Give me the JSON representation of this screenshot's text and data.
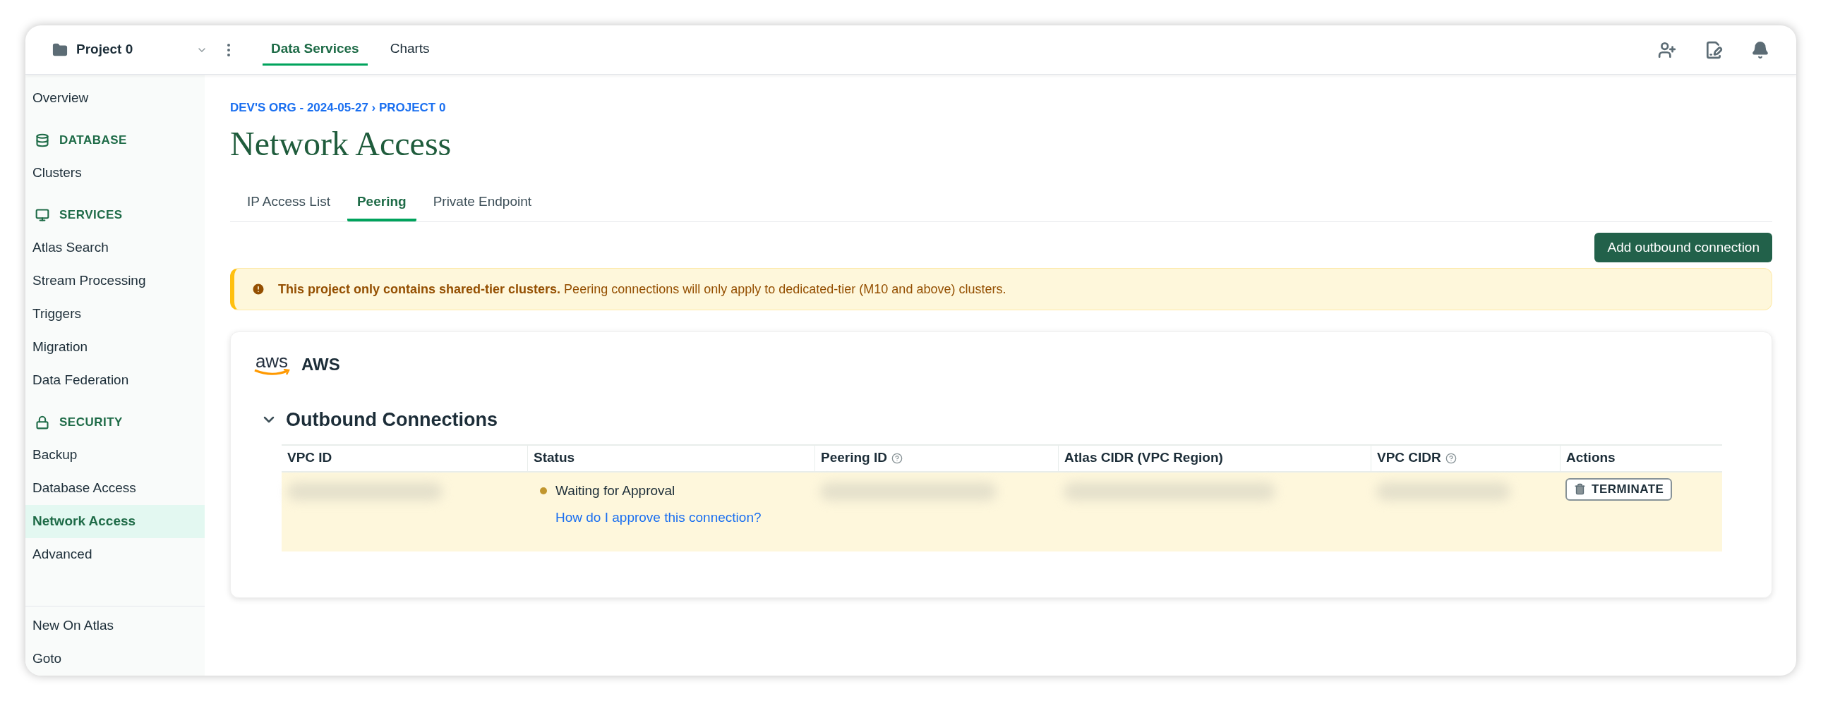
{
  "topbar": {
    "project": "Project 0",
    "nav": [
      {
        "label": "Data Services",
        "selected": true
      },
      {
        "label": "Charts",
        "selected": false
      }
    ]
  },
  "sidebar": {
    "items": [
      {
        "kind": "link",
        "label": "Overview",
        "selected": false
      },
      {
        "kind": "section",
        "label": "DATABASE"
      },
      {
        "kind": "link",
        "label": "Clusters",
        "selected": false
      },
      {
        "kind": "section",
        "label": "SERVICES"
      },
      {
        "kind": "link",
        "label": "Atlas Search",
        "selected": false
      },
      {
        "kind": "link",
        "label": "Stream Processing",
        "selected": false
      },
      {
        "kind": "link",
        "label": "Triggers",
        "selected": false
      },
      {
        "kind": "link",
        "label": "Migration",
        "selected": false
      },
      {
        "kind": "link",
        "label": "Data Federation",
        "selected": false
      },
      {
        "kind": "section",
        "label": "SECURITY"
      },
      {
        "kind": "link",
        "label": "Backup",
        "selected": false
      },
      {
        "kind": "link",
        "label": "Database Access",
        "selected": false
      },
      {
        "kind": "link",
        "label": "Network Access",
        "selected": true
      },
      {
        "kind": "link",
        "label": "Advanced",
        "selected": false
      }
    ],
    "footer": [
      "New On Atlas",
      "Goto"
    ]
  },
  "breadcrumb": "DEV'S ORG - 2024-05-27 › PROJECT 0",
  "title": "Network Access",
  "tabs": [
    {
      "label": "IP Access List",
      "selected": false
    },
    {
      "label": "Peering",
      "selected": true
    },
    {
      "label": "Private Endpoint",
      "selected": false
    }
  ],
  "primary_button": "Add outbound connection",
  "banner": {
    "text": "**This project only contains shared-tier clusters.** Peering connections will only apply to dedicated-tier (M10 and above) clusters."
  },
  "provider": {
    "logo_text": "aws",
    "name": "AWS"
  },
  "section": {
    "title": "Outbound Connections",
    "expanded": true
  },
  "table": {
    "columns": [
      {
        "label": "VPC ID",
        "help": false
      },
      {
        "label": "Status",
        "help": false
      },
      {
        "label": "Peering ID",
        "help": true
      },
      {
        "label": "Atlas CIDR (VPC Region)",
        "help": false
      },
      {
        "label": "VPC CIDR",
        "help": true
      },
      {
        "label": "Actions",
        "help": false
      }
    ],
    "rows": [
      {
        "status": "Waiting for Approval",
        "color": "#c1962e",
        "help_link": "How do I approve this connection?",
        "action": "TERMINATE",
        "highlighted": true
      }
    ]
  }
}
